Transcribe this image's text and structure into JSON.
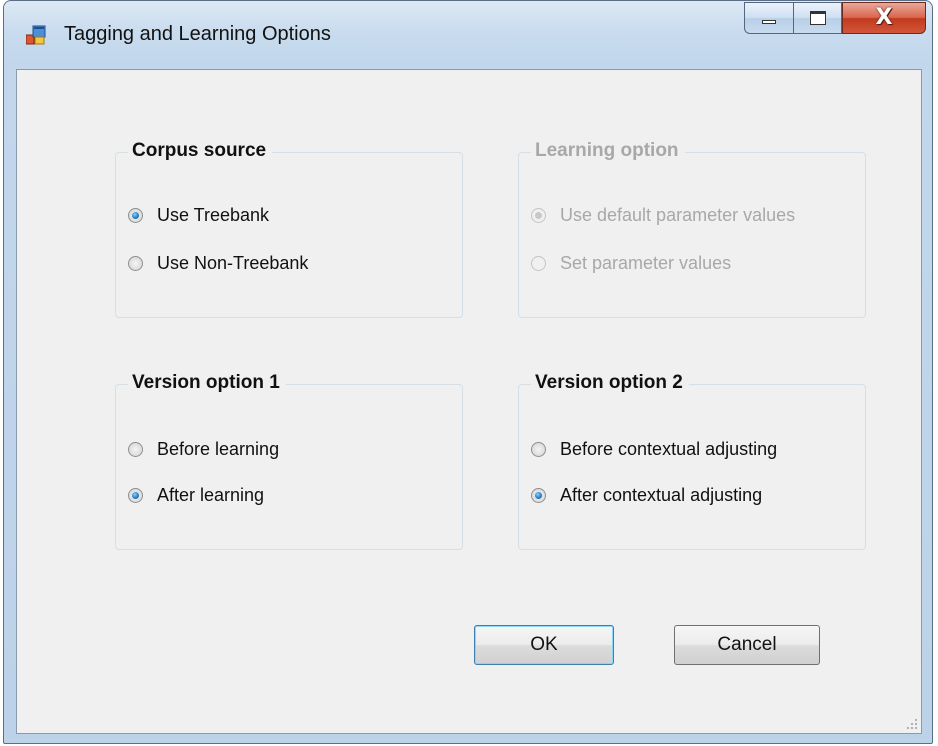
{
  "window": {
    "title": "Tagging and Learning Options",
    "controls": {
      "close": "X"
    }
  },
  "corpus_source": {
    "legend": "Corpus source",
    "options": [
      {
        "label": "Use Treebank",
        "checked": true
      },
      {
        "label": "Use Non-Treebank",
        "checked": false
      }
    ]
  },
  "learning_option": {
    "legend": "Learning option",
    "disabled": true,
    "options": [
      {
        "label": "Use default parameter values",
        "checked": true
      },
      {
        "label": "Set parameter values",
        "checked": false
      }
    ]
  },
  "version_option_1": {
    "legend": "Version option 1",
    "options": [
      {
        "label": "Before learning",
        "checked": false
      },
      {
        "label": "After learning",
        "checked": true
      }
    ]
  },
  "version_option_2": {
    "legend": "Version option 2",
    "options": [
      {
        "label": "Before contextual adjusting",
        "checked": false
      },
      {
        "label": "After contextual adjusting",
        "checked": true
      }
    ]
  },
  "buttons": {
    "ok": "OK",
    "cancel": "Cancel"
  },
  "colors": {
    "radio_dot": "#2e86c9",
    "close_button": "#c23a1d",
    "disabled_text": "#a8a8a8"
  }
}
